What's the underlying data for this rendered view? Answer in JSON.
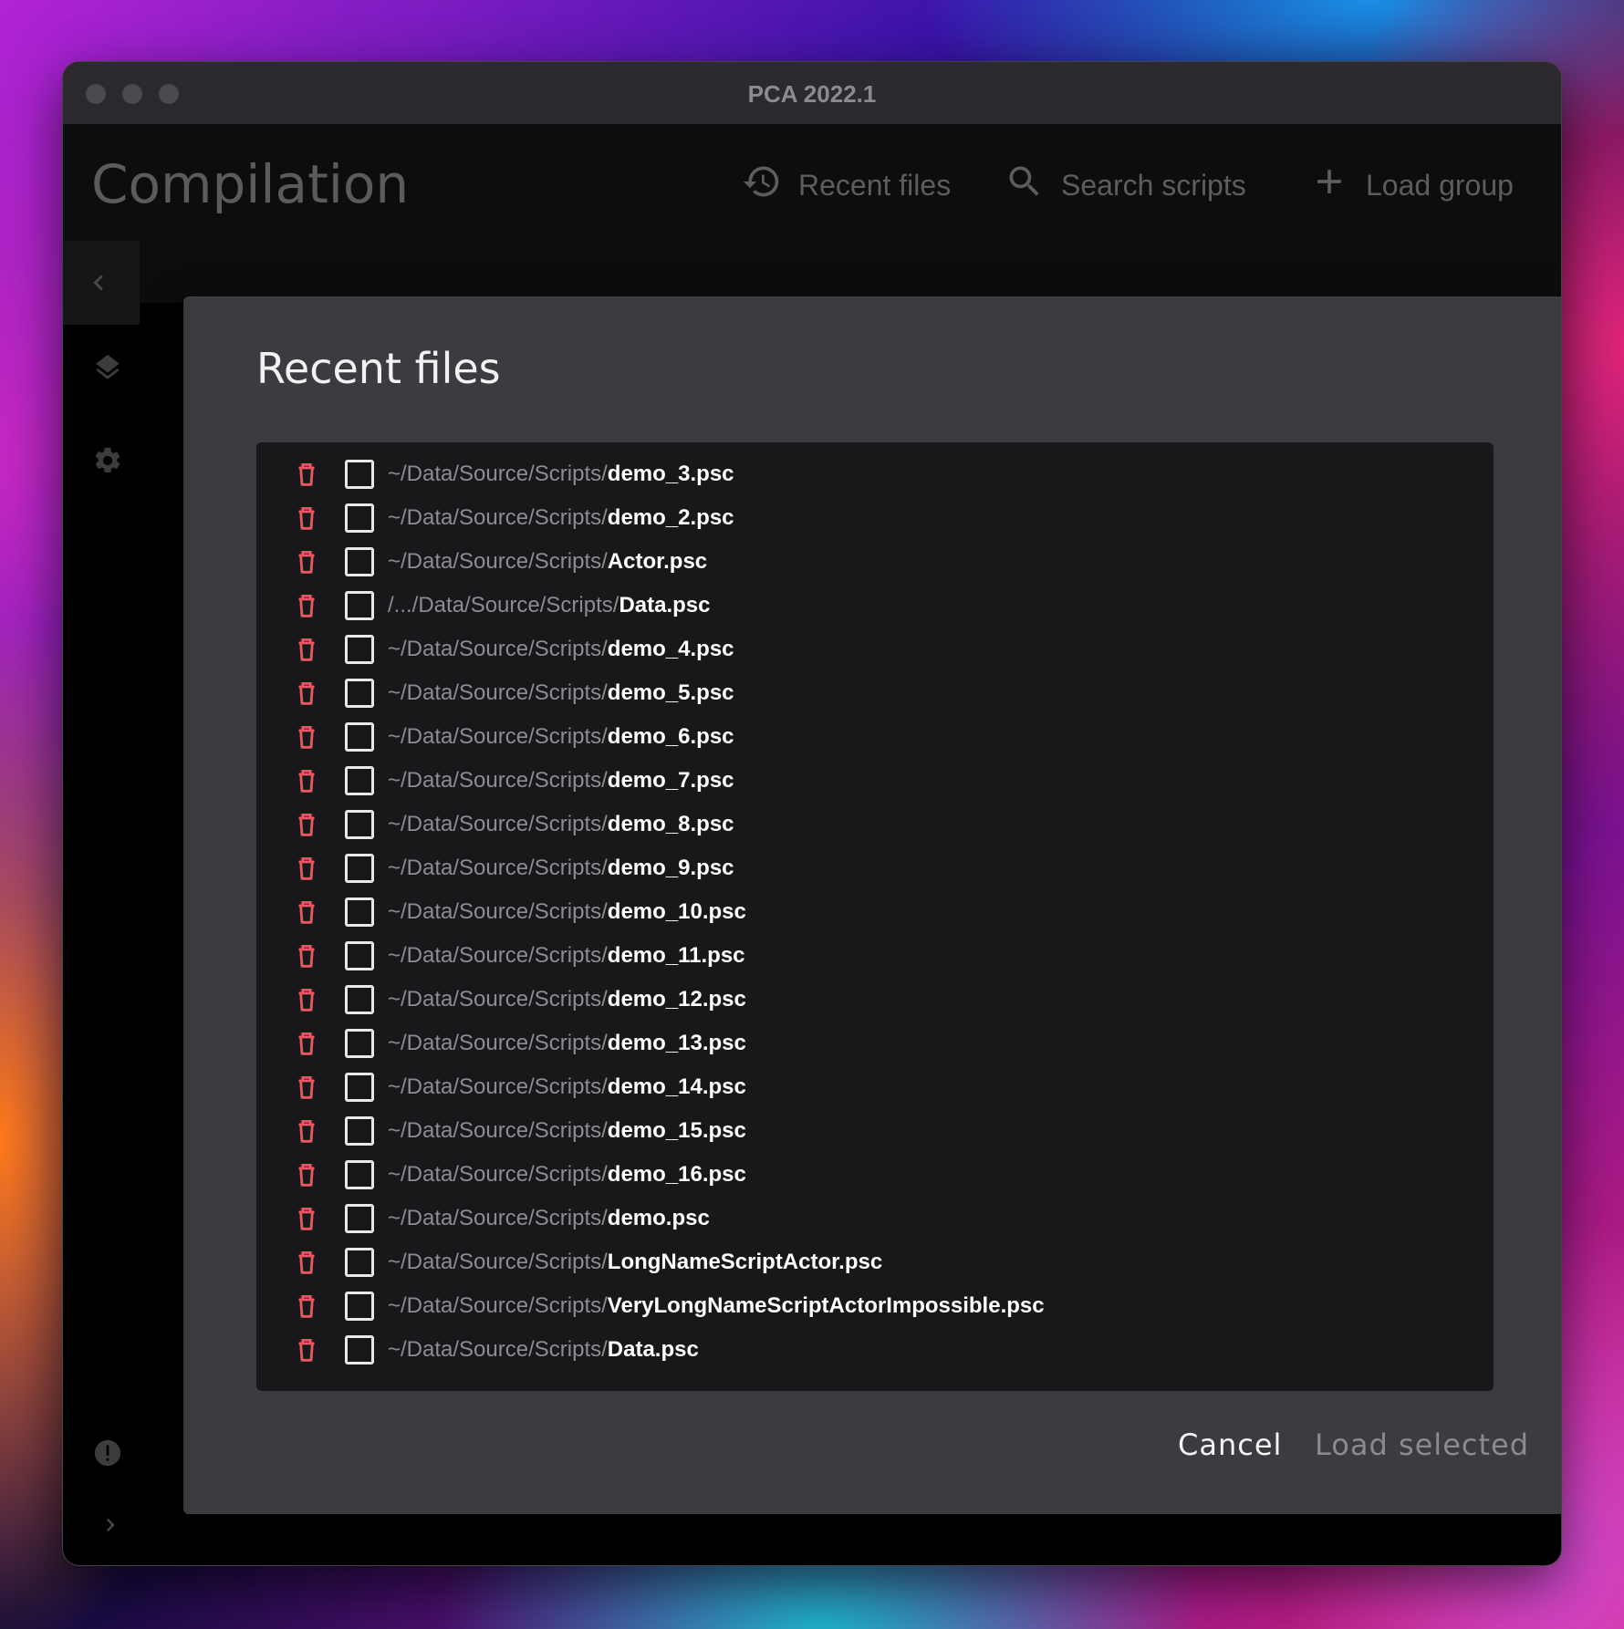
{
  "window": {
    "title": "PCA 2022.1"
  },
  "appbar": {
    "title": "Compilation",
    "actions": [
      {
        "label": "Recent files",
        "icon": "history-icon"
      },
      {
        "label": "Search scripts",
        "icon": "search-icon"
      },
      {
        "label": "Load group",
        "icon": "plus-icon"
      }
    ]
  },
  "dialog": {
    "title": "Recent files",
    "files": [
      {
        "dir": "~/Data/Source/Scripts/",
        "name": "demo_3.psc"
      },
      {
        "dir": "~/Data/Source/Scripts/",
        "name": "demo_2.psc"
      },
      {
        "dir": "~/Data/Source/Scripts/",
        "name": "Actor.psc"
      },
      {
        "dir": "/.../Data/Source/Scripts/",
        "name": "Data.psc"
      },
      {
        "dir": "~/Data/Source/Scripts/",
        "name": "demo_4.psc"
      },
      {
        "dir": "~/Data/Source/Scripts/",
        "name": "demo_5.psc"
      },
      {
        "dir": "~/Data/Source/Scripts/",
        "name": "demo_6.psc"
      },
      {
        "dir": "~/Data/Source/Scripts/",
        "name": "demo_7.psc"
      },
      {
        "dir": "~/Data/Source/Scripts/",
        "name": "demo_8.psc"
      },
      {
        "dir": "~/Data/Source/Scripts/",
        "name": "demo_9.psc"
      },
      {
        "dir": "~/Data/Source/Scripts/",
        "name": "demo_10.psc"
      },
      {
        "dir": "~/Data/Source/Scripts/",
        "name": "demo_11.psc"
      },
      {
        "dir": "~/Data/Source/Scripts/",
        "name": "demo_12.psc"
      },
      {
        "dir": "~/Data/Source/Scripts/",
        "name": "demo_13.psc"
      },
      {
        "dir": "~/Data/Source/Scripts/",
        "name": "demo_14.psc"
      },
      {
        "dir": "~/Data/Source/Scripts/",
        "name": "demo_15.psc"
      },
      {
        "dir": "~/Data/Source/Scripts/",
        "name": "demo_16.psc"
      },
      {
        "dir": "~/Data/Source/Scripts/",
        "name": "demo.psc"
      },
      {
        "dir": "~/Data/Source/Scripts/",
        "name": "LongNameScriptActor.psc"
      },
      {
        "dir": "~/Data/Source/Scripts/",
        "name": "VeryLongNameScriptActorImpossible.psc"
      },
      {
        "dir": "~/Data/Source/Scripts/",
        "name": "Data.psc"
      }
    ],
    "cancel_label": "Cancel",
    "load_label": "Load selected"
  },
  "colors": {
    "trash": "#e8595f",
    "dialog_bg": "#3c3b3f",
    "list_bg": "#18181b"
  }
}
